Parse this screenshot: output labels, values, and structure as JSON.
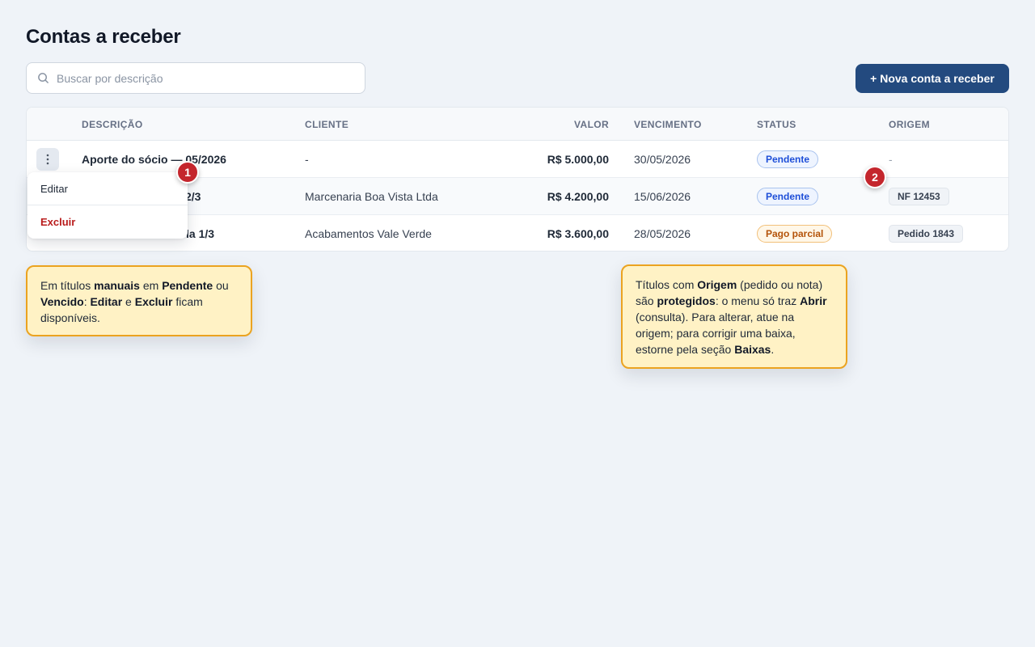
{
  "page": {
    "title": "Contas a receber"
  },
  "search": {
    "placeholder": "Buscar por descrição"
  },
  "toolbar": {
    "new_button_label": "+ Nova conta a receber"
  },
  "table": {
    "columns": [
      "DESCRIÇÃO",
      "CLIENTE",
      "VALOR",
      "VENCIMENTO",
      "STATUS",
      "ORIGEM"
    ],
    "rows": [
      {
        "descricao": "Aporte do sócio — 05/2026",
        "cliente": "-",
        "valor": "R$ 5.000,00",
        "vencimento": "30/05/2026",
        "status": "Pendente",
        "origem": "-"
      },
      {
        "descricao": "2/3",
        "cliente": "Marcenaria Boa Vista Ltda",
        "valor": "R$ 4.200,00",
        "vencimento": "15/06/2026",
        "status": "Pendente",
        "origem": "NF 12453"
      },
      {
        "descricao": "la 1/3",
        "cliente": "Acabamentos Vale Verde",
        "valor": "R$ 3.600,00",
        "vencimento": "28/05/2026",
        "status": "Pago parcial",
        "origem": "Pedido 1843"
      }
    ]
  },
  "row_menu": {
    "edit_label": "Editar",
    "delete_label": "Excluir"
  },
  "markers": {
    "one": "1",
    "two": "2"
  },
  "callouts": {
    "left": [
      {
        "t": "Em títulos ",
        "b": false
      },
      {
        "t": "manuais",
        "b": true
      },
      {
        "t": " em ",
        "b": false
      },
      {
        "t": "Pendente",
        "b": true
      },
      {
        "t": " ou ",
        "b": false
      },
      {
        "t": "Vencido",
        "b": true
      },
      {
        "t": ": ",
        "b": false
      },
      {
        "t": "Editar",
        "b": true
      },
      {
        "t": " e ",
        "b": false
      },
      {
        "t": "Excluir",
        "b": true
      },
      {
        "t": " ficam disponíveis.",
        "b": false
      }
    ],
    "right": [
      {
        "t": "Títulos com ",
        "b": false
      },
      {
        "t": "Origem",
        "b": true
      },
      {
        "t": " (pedido ou nota) são ",
        "b": false
      },
      {
        "t": "protegidos",
        "b": true
      },
      {
        "t": ": o menu só traz ",
        "b": false
      },
      {
        "t": "Abrir",
        "b": true
      },
      {
        "t": " (consulta). Para alterar, atue na origem; para corrigir uma baixa, estorne pela seção ",
        "b": false
      },
      {
        "t": "Baixas",
        "b": true
      },
      {
        "t": ".",
        "b": false
      }
    ]
  },
  "colors": {
    "primary": "#234a7f",
    "danger": "#b91c1c",
    "marker": "#c4262d",
    "callout_bg": "#fff2c5",
    "callout_border": "#eba320"
  },
  "icons": {
    "search": "search-icon",
    "row_menu": "kebab-menu-icon"
  }
}
